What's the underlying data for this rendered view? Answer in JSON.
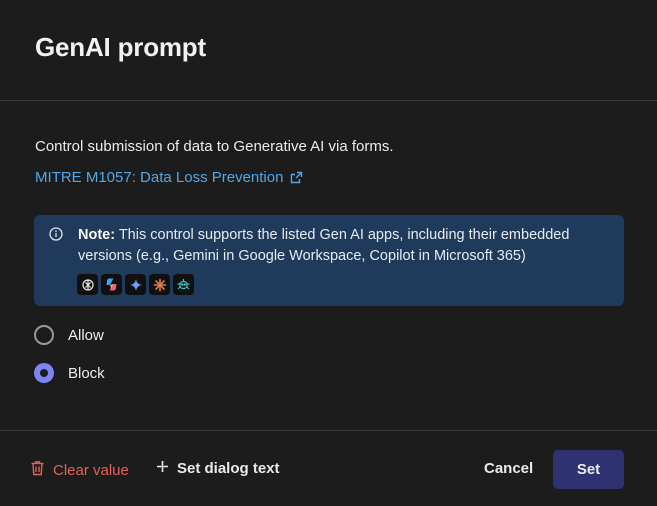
{
  "dialog": {
    "title": "GenAI prompt",
    "description": "Control submission of data to Generative AI via forms.",
    "link_text": "MITRE M1057: Data Loss Prevention"
  },
  "note": {
    "label": "Note:",
    "text": " This control supports the listed Gen AI apps, including their embedded versions (e.g., Gemini in Google Workspace, Copilot in Microsoft 365)",
    "apps": [
      "chatgpt-icon",
      "copilot-icon",
      "gemini-icon",
      "claude-icon",
      "deepseek-icon"
    ]
  },
  "options": [
    {
      "label": "Allow",
      "selected": false
    },
    {
      "label": "Block",
      "selected": true
    }
  ],
  "footer": {
    "clear_label": "Clear value",
    "dialog_text_label": "Set dialog text",
    "cancel_label": "Cancel",
    "set_label": "Set"
  },
  "colors": {
    "background": "#1c1c1c",
    "link": "#4ea8ea",
    "note_bg": "#1f3a5a",
    "radio_accent": "#7d86f0",
    "danger": "#e0625c",
    "primary_button": "#2f3270"
  }
}
